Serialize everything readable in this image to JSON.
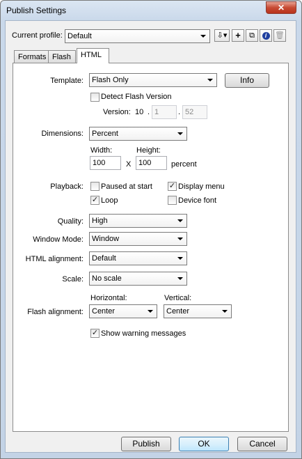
{
  "window": {
    "title": "Publish Settings",
    "close_glyph": "✕"
  },
  "profile": {
    "label": "Current profile:",
    "value": "Default"
  },
  "toolbar": {
    "import_export_glyph": "⇩▾",
    "add_glyph": "+",
    "duplicate_glyph": "⧉",
    "info_glyph": "i",
    "delete_glyph": "🗑"
  },
  "tabs": [
    "Formats",
    "Flash",
    "HTML"
  ],
  "html_tab": {
    "template": {
      "label": "Template:",
      "value": "Flash Only",
      "info_button": "Info"
    },
    "detect_flash": {
      "label": "Detect Flash Version",
      "checked": false
    },
    "version": {
      "label": "Version:",
      "major": "10",
      "minor": "1",
      "revision": "52",
      "sep": "."
    },
    "dimensions": {
      "label": "Dimensions:",
      "value": "Percent"
    },
    "width": {
      "label": "Width:",
      "value": "100"
    },
    "height": {
      "label": "Height:",
      "value": "100"
    },
    "x_label": "X",
    "unit": "percent",
    "playback": {
      "label": "Playback:",
      "paused_at_start": {
        "label": "Paused at start",
        "checked": false
      },
      "display_menu": {
        "label": "Display menu",
        "checked": true
      },
      "loop": {
        "label": "Loop",
        "checked": true
      },
      "device_font": {
        "label": "Device font",
        "checked": false
      }
    },
    "quality": {
      "label": "Quality:",
      "value": "High"
    },
    "window_mode": {
      "label": "Window Mode:",
      "value": "Window"
    },
    "html_alignment": {
      "label": "HTML alignment:",
      "value": "Default"
    },
    "scale": {
      "label": "Scale:",
      "value": "No scale"
    },
    "flash_alignment": {
      "label": "Flash alignment:",
      "horizontal_label": "Horizontal:",
      "horizontal_value": "Center",
      "vertical_label": "Vertical:",
      "vertical_value": "Center"
    },
    "show_warnings": {
      "label": "Show warning messages",
      "checked": true
    }
  },
  "footer": {
    "publish": "Publish",
    "ok": "OK",
    "cancel": "Cancel"
  },
  "check_glyph": "✓"
}
